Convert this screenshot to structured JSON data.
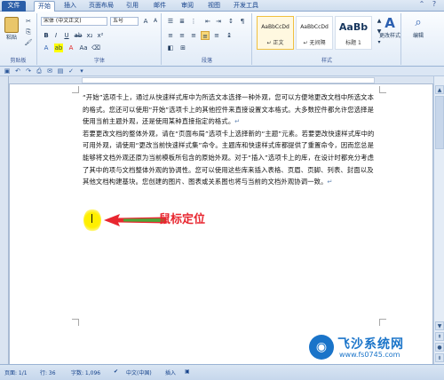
{
  "tabs": [
    "文件",
    "开始",
    "插入",
    "页面布局",
    "引用",
    "邮件",
    "审阅",
    "视图",
    "开发工具"
  ],
  "ribbon": {
    "clipboard": {
      "label": "剪贴板",
      "paste": "粘贴"
    },
    "font": {
      "label": "字体",
      "font_name": "宋体 (中文正文)",
      "font_size": "五号"
    },
    "paragraph": {
      "label": "段落"
    },
    "styles": {
      "label": "样式",
      "items": [
        {
          "preview": "AaBbCcDd",
          "name": "↵ 正文"
        },
        {
          "preview": "AaBbCcDd",
          "name": "↵ 无间隔"
        },
        {
          "preview": "AaBb",
          "name": "标题 1"
        }
      ],
      "change_styles": "更改样式",
      "edit": "编辑"
    }
  },
  "document": {
    "paragraph1": "“开始”选项卡上，通过从快速样式库中为所选文本选择一种外观，您可以方便地更改文档中所选文本的格式。您还可以使用“开始”选项卡上的其他控件来直接设置文本格式。大多数控件都允许您选择是使用当前主题外观，还是使用某种直接指定的格式。",
    "paragraph2": "若要更改文档的整体外观，请在“页面布局”选项卡上选择新的“主题”元素。若要更改快速样式库中的可用外观，请使用“更改当前快速样式集”命令。主题库和快速样式库都提供了重置命令，因而您总是能够将文档外观还原为当前模板所包含的原始外观。对于“插入”选项卡上的库，在设计时都充分考虑了其中的项与文档整体外观的协调性。您可以使用这些库来插入表格、页眉、页脚、列表、封面以及其他文档构建基块。您创建的图片、图表或关系图也将与当前的文档外观协调一致。",
    "para_mark": "↵"
  },
  "annotation": "鼠标定位",
  "status": {
    "page": "页面: 1/1",
    "line": "行: 36",
    "words": "字数: 1,096",
    "language": "中文(中国)",
    "mode": "插入"
  },
  "watermark": {
    "site": "飞沙系统网",
    "url": "www.fs0745.com"
  },
  "colors": {
    "accent": "#2a5ea8",
    "annotation": "#e8262f",
    "highlight": "#ffef00"
  }
}
